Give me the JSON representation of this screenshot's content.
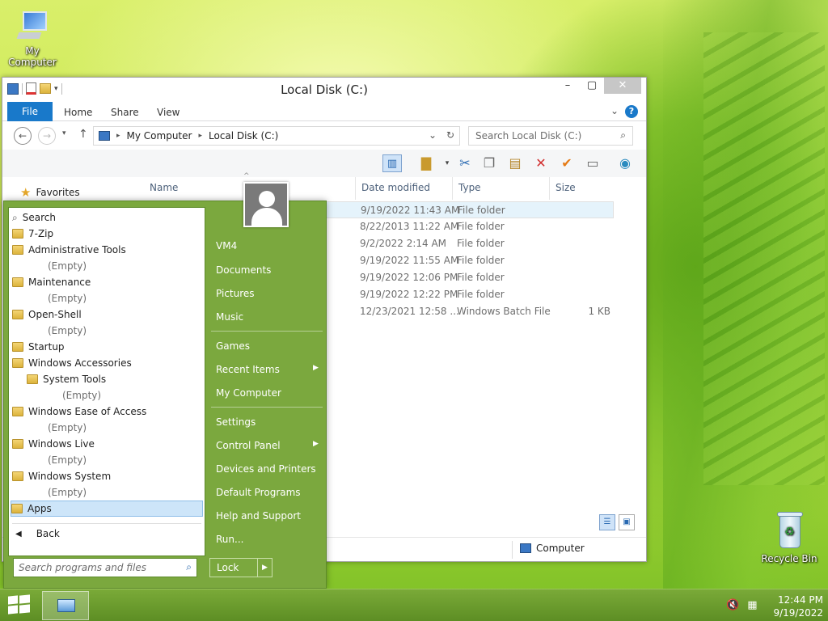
{
  "desktop": {
    "icons": [
      {
        "label": "My Computer"
      },
      {
        "label": "Recycle Bin"
      }
    ]
  },
  "explorer": {
    "title": "Local Disk (C:)",
    "ribbon_tabs": [
      "File",
      "Home",
      "Share",
      "View"
    ],
    "address": {
      "crumbs": [
        "My Computer",
        "Local Disk (C:)"
      ]
    },
    "search_placeholder": "Search Local Disk (C:)",
    "nav_favorites": "Favorites",
    "columns": [
      "Name",
      "Date modified",
      "Type",
      "Size"
    ],
    "rows": [
      {
        "date": "9/19/2022 11:43 AM",
        "type": "File folder",
        "size": ""
      },
      {
        "date": "8/22/2013 11:22 AM",
        "type": "File folder",
        "size": ""
      },
      {
        "date": "9/2/2022 2:14 AM",
        "type": "File folder",
        "size": ""
      },
      {
        "date": "9/19/2022 11:55 AM",
        "type": "File folder",
        "size": ""
      },
      {
        "date": "9/19/2022 12:06 PM",
        "type": "File folder",
        "size": ""
      },
      {
        "date": "9/19/2022 12:22 PM",
        "type": "File folder",
        "size": ""
      },
      {
        "date": "12/23/2021 12:58 ...",
        "type": "Windows Batch File",
        "size": "1 KB"
      }
    ],
    "status_location": "Computer"
  },
  "start_menu": {
    "programs": [
      {
        "label": "Search",
        "kind": "search",
        "indent": 0
      },
      {
        "label": "7-Zip",
        "kind": "folder",
        "indent": 0
      },
      {
        "label": "Administrative Tools",
        "kind": "folder",
        "indent": 0
      },
      {
        "label": "(Empty)",
        "kind": "empty",
        "indent": 1
      },
      {
        "label": "Maintenance",
        "kind": "folder",
        "indent": 0
      },
      {
        "label": "(Empty)",
        "kind": "empty",
        "indent": 1
      },
      {
        "label": "Open-Shell",
        "kind": "folder",
        "indent": 0
      },
      {
        "label": "(Empty)",
        "kind": "empty",
        "indent": 1
      },
      {
        "label": "Startup",
        "kind": "folder",
        "indent": 0
      },
      {
        "label": "Windows Accessories",
        "kind": "folder",
        "indent": 0
      },
      {
        "label": "System Tools",
        "kind": "folder",
        "indent": 1
      },
      {
        "label": "(Empty)",
        "kind": "empty",
        "indent": 2
      },
      {
        "label": "Windows Ease of Access",
        "kind": "folder",
        "indent": 0
      },
      {
        "label": "(Empty)",
        "kind": "empty",
        "indent": 1
      },
      {
        "label": "Windows Live",
        "kind": "folder",
        "indent": 0
      },
      {
        "label": "(Empty)",
        "kind": "empty",
        "indent": 1
      },
      {
        "label": "Windows System",
        "kind": "folder",
        "indent": 0
      },
      {
        "label": "(Empty)",
        "kind": "empty",
        "indent": 1
      },
      {
        "label": "Apps",
        "kind": "apps",
        "indent": 0
      }
    ],
    "back_label": "Back",
    "search_placeholder": "Search programs and files",
    "right_items": [
      {
        "label": "VM4",
        "arrow": false
      },
      {
        "label": "Documents",
        "arrow": false
      },
      {
        "label": "Pictures",
        "arrow": false
      },
      {
        "label": "Music",
        "arrow": false
      },
      {
        "label": "Games",
        "arrow": false
      },
      {
        "label": "Recent Items",
        "arrow": true
      },
      {
        "label": "My Computer",
        "arrow": false
      },
      {
        "label": "Settings",
        "arrow": false
      },
      {
        "label": "Control Panel",
        "arrow": true
      },
      {
        "label": "Devices and Printers",
        "arrow": false
      },
      {
        "label": "Default Programs",
        "arrow": false
      },
      {
        "label": "Help and Support",
        "arrow": false
      },
      {
        "label": "Run...",
        "arrow": false
      }
    ],
    "lock_label": "Lock"
  },
  "taskbar": {
    "time": "12:44 PM",
    "date": "9/19/2022"
  },
  "colors": {
    "start_menu_bg": "#7ba83e",
    "ribbon_file": "#1979ca",
    "taskbar": "#5d8e24"
  }
}
